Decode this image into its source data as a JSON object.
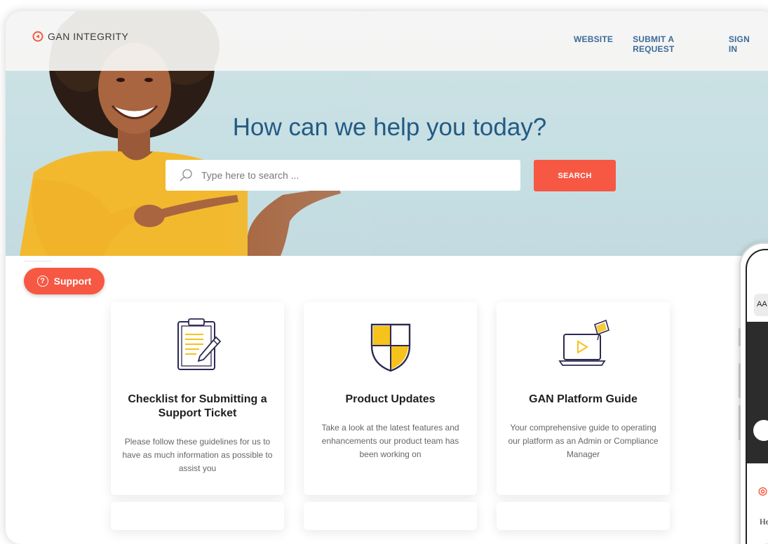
{
  "header": {
    "brand": "GAN INTEGRITY",
    "nav": [
      {
        "label": "WEBSITE"
      },
      {
        "label": "SUBMIT A REQUEST"
      },
      {
        "label": "SIGN IN"
      }
    ]
  },
  "hero": {
    "title": "How can we help you today?",
    "search": {
      "placeholder": "Type here to search ...",
      "value": "",
      "button_label": "SEARCH"
    }
  },
  "support_widget": {
    "label": "Support",
    "icon": "help-circle-icon"
  },
  "cards": [
    {
      "icon": "clipboard-checklist-icon",
      "title": "Checklist for Submitting a Support Ticket",
      "description": "Please follow these guidelines for us to have as much information as possible to assist you"
    },
    {
      "icon": "shield-icon",
      "title": "Product Updates",
      "description": "Take a look at the latest features and enhancements our product team has been working on"
    },
    {
      "icon": "laptop-graduation-icon",
      "title": "GAN Platform Guide",
      "description": "Your comprehensive guide to operating our platform as an Admin or Compliance Manager"
    }
  ],
  "phone_preview": {
    "address_bar_text": "AA",
    "text_fragment": "He"
  },
  "colors": {
    "accent": "#f65843",
    "heading_blue": "#235a83",
    "nav_blue": "#3d6a99",
    "hero_bg": "#c6dfe3",
    "icon_yellow": "#f6c21c",
    "icon_navy": "#2c2a52"
  }
}
